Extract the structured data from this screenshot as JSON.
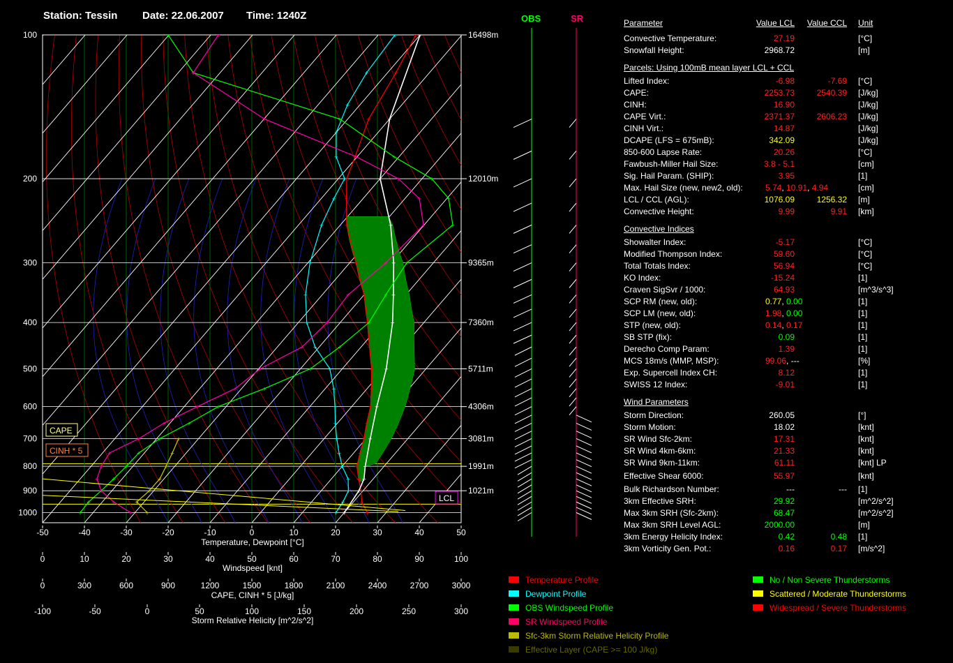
{
  "header": {
    "station": "Station: Tessin",
    "date": "Date: 22.06.2007",
    "time": "Time: 1240Z"
  },
  "chart_data": {
    "type": "line",
    "title": "",
    "xlabel": "Temperature, Dewpoint [°C]",
    "x_ticks": [
      "-50",
      "-40",
      "-30",
      "-20",
      "-10",
      "0",
      "10",
      "20",
      "30",
      "40",
      "50"
    ],
    "y_ticks": [
      "100",
      "200",
      "300",
      "400",
      "500",
      "600",
      "700",
      "800",
      "900",
      "1000"
    ],
    "xlim": [
      -50,
      50
    ],
    "ylim": [
      1000,
      100
    ],
    "y_scale": "log",
    "height_labels": [
      "16498m",
      "12010m",
      "9365m",
      "7360m",
      "5711m",
      "4306m",
      "3081m",
      "1991m",
      "1021m"
    ],
    "height_pressures": [
      100,
      200,
      300,
      400,
      500,
      600,
      700,
      800,
      900
    ],
    "axis2": {
      "label": "Windspeed [knt]",
      "ticks": [
        "0",
        "10",
        "20",
        "30",
        "40",
        "50",
        "60",
        "70",
        "80",
        "90",
        "100"
      ]
    },
    "axis3": {
      "label": "CAPE, CINH * 5 [J/kg]",
      "ticks": [
        "0",
        "300",
        "600",
        "900",
        "1200",
        "1500",
        "1800",
        "2100",
        "2400",
        "2700",
        "3000"
      ]
    },
    "axis4": {
      "label": "Storm Relative Helicity [m^2/s^2]",
      "ticks": [
        "-100",
        "-50",
        "0",
        "50",
        "100",
        "150",
        "200",
        "250",
        "300"
      ]
    },
    "series": [
      {
        "name": "Temperature Profile",
        "color": "#ff0000",
        "points": [
          [
            1000,
            25.5
          ],
          [
            950,
            22.0
          ],
          [
            900,
            19.5
          ],
          [
            850,
            16.5
          ],
          [
            800,
            13.5
          ],
          [
            750,
            11.5
          ],
          [
            700,
            9.5
          ],
          [
            650,
            7.0
          ],
          [
            600,
            4.5
          ],
          [
            550,
            1.0
          ],
          [
            500,
            -3.0
          ],
          [
            450,
            -8.0
          ],
          [
            400,
            -13.5
          ],
          [
            350,
            -20.0
          ],
          [
            300,
            -28.5
          ],
          [
            250,
            -38.5
          ],
          [
            220,
            -44.0
          ],
          [
            200,
            -48.0
          ],
          [
            180,
            -50.5
          ],
          [
            150,
            -55.0
          ],
          [
            120,
            -58.0
          ],
          [
            100,
            -61.0
          ]
        ]
      },
      {
        "name": "Dewpoint Profile",
        "color": "#00ffff",
        "points": [
          [
            1000,
            18.0
          ],
          [
            950,
            17.5
          ],
          [
            900,
            16.5
          ],
          [
            850,
            14.0
          ],
          [
            800,
            10.0
          ],
          [
            750,
            6.5
          ],
          [
            700,
            3.0
          ],
          [
            650,
            -0.5
          ],
          [
            600,
            -4.0
          ],
          [
            550,
            -8.0
          ],
          [
            500,
            -13.0
          ],
          [
            450,
            -21.0
          ],
          [
            400,
            -28.0
          ],
          [
            350,
            -34.0
          ],
          [
            300,
            -39.5
          ],
          [
            250,
            -44.5
          ],
          [
            220,
            -47.0
          ],
          [
            200,
            -48.5
          ],
          [
            180,
            -55.0
          ],
          [
            160,
            -60.0
          ],
          [
            140,
            -63.0
          ],
          [
            120,
            -65.0
          ],
          [
            100,
            -66.0
          ]
        ]
      },
      {
        "name": "Parcel",
        "color": "#ffffff",
        "points": [
          [
            1000,
            20.0
          ],
          [
            900,
            19.0
          ],
          [
            850,
            17.8
          ],
          [
            800,
            15.5
          ],
          [
            700,
            11.0
          ],
          [
            600,
            6.0
          ],
          [
            500,
            0.5
          ],
          [
            400,
            -7.5
          ],
          [
            350,
            -13.0
          ],
          [
            300,
            -19.5
          ],
          [
            250,
            -28.0
          ],
          [
            200,
            -40.0
          ],
          [
            150,
            -50.0
          ],
          [
            100,
            -60.0
          ]
        ]
      },
      {
        "name": "OBS Windspeed Profile",
        "color": "#00ff00",
        "points": [
          [
            1000,
            9
          ],
          [
            950,
            11
          ],
          [
            900,
            14
          ],
          [
            850,
            17
          ],
          [
            800,
            20
          ],
          [
            750,
            23
          ],
          [
            700,
            28
          ],
          [
            650,
            35
          ],
          [
            600,
            42
          ],
          [
            550,
            53
          ],
          [
            500,
            64
          ],
          [
            450,
            71
          ],
          [
            400,
            78
          ],
          [
            350,
            82
          ],
          [
            300,
            87
          ],
          [
            250,
            98
          ],
          [
            220,
            97
          ],
          [
            200,
            93
          ],
          [
            180,
            84
          ],
          [
            150,
            71
          ],
          [
            120,
            36
          ],
          [
            100,
            30
          ]
        ]
      },
      {
        "name": "SR Windspeed Profile",
        "color": "#ff00aa",
        "points": [
          [
            1000,
            21
          ],
          [
            950,
            17
          ],
          [
            900,
            14
          ],
          [
            850,
            13
          ],
          [
            800,
            14
          ],
          [
            750,
            16
          ],
          [
            700,
            23
          ],
          [
            650,
            29
          ],
          [
            600,
            37
          ],
          [
            550,
            46
          ],
          [
            500,
            52
          ],
          [
            450,
            62
          ],
          [
            400,
            68
          ],
          [
            350,
            73
          ],
          [
            300,
            82
          ],
          [
            250,
            91
          ],
          [
            220,
            90
          ],
          [
            200,
            85
          ],
          [
            180,
            75
          ],
          [
            150,
            53
          ],
          [
            120,
            36
          ],
          [
            100,
            42
          ]
        ]
      },
      {
        "name": "Sfc-3km Storm Relative Helicity Profile",
        "color": "#cccc00",
        "points": [
          [
            1000,
            0
          ],
          [
            950,
            -10
          ],
          [
            900,
            2
          ],
          [
            850,
            12
          ],
          [
            800,
            18
          ],
          [
            750,
            24
          ],
          [
            700,
            30
          ]
        ]
      }
    ],
    "cape_label": "CAPE",
    "cinh_label": "CINH * 5",
    "lcl_label": "LCL",
    "legend_placement": "bottom"
  },
  "wind": {
    "obs_label": "OBS",
    "sr_label": "SR",
    "obs_color": "#00ff00",
    "sr_color": "#ff0066"
  },
  "params": {
    "hdr": {
      "name": "Parameter",
      "v1": "Value LCL",
      "v2": "Value CCL",
      "unit": "Unit"
    },
    "rows": [
      {
        "name": "Convective Temperature:",
        "v1": "27.19",
        "c1": "#ff2020",
        "v2": "",
        "unit": "[°C]"
      },
      {
        "name": "Snowfall Height:",
        "v1": "2968.72",
        "c1": "#ffffff",
        "v2": "",
        "unit": "[m]"
      },
      {
        "section": "Parcels: Using 100mB mean layer LCL + CCL"
      },
      {
        "name": "Lifted Index:",
        "v1": "-6.98",
        "c1": "#ff2020",
        "v2": "-7.69",
        "c2": "#ff2020",
        "unit": "[°C]"
      },
      {
        "name": "CAPE:",
        "v1": "2253.73",
        "c1": "#ff2020",
        "v2": "2540.39",
        "c2": "#ff2020",
        "unit": "[J/kg]"
      },
      {
        "name": "CINH:",
        "v1": "16.90",
        "c1": "#ff2020",
        "v2": "",
        "unit": "[J/kg]"
      },
      {
        "name": "CAPE Virt.:",
        "v1": "2371.37",
        "c1": "#ff2020",
        "v2": "2606.23",
        "c2": "#ff2020",
        "unit": "[J/kg]"
      },
      {
        "name": "CINH Virt.:",
        "v1": "14.87",
        "c1": "#ff2020",
        "v2": "",
        "unit": "[J/kg]"
      },
      {
        "name": "DCAPE (LFS = 675mB):",
        "v1": "342.09",
        "c1": "#ffff00",
        "v2": "",
        "unit": "[J/kg]"
      },
      {
        "name": "850-600 Lapse Rate:",
        "v1": "20.26",
        "c1": "#ff2020",
        "v2": "",
        "unit": "[°C]"
      },
      {
        "name": "Fawbush-Miller Hail Size:",
        "v1": "3.8 - 5.1",
        "c1": "#ff2020",
        "v2": "",
        "unit": "[cm]"
      },
      {
        "name": "Sig. Hail Param. (SHIP):",
        "v1": "3.95",
        "c1": "#ff2020",
        "v2": "",
        "unit": "[1]"
      },
      {
        "name": "Max. Hail Size (new, new2, old):",
        "multi": [
          [
            "5.74",
            "#ff2020"
          ],
          [
            ", ",
            "#ffffff"
          ],
          [
            "10.91",
            "#ff2020"
          ],
          [
            ", ",
            "#ffffff"
          ],
          [
            "4.94",
            "#ff2020"
          ]
        ],
        "unit": "[cm]"
      },
      {
        "name": "LCL / CCL (AGL):",
        "v1": "1076.09",
        "c1": "#ffff00",
        "v2": "1256.32",
        "c2": "#ffff00",
        "unit": "[m]"
      },
      {
        "name": "Convective Height:",
        "v1": "9.99",
        "c1": "#ff2020",
        "v2": "9.91",
        "c2": "#ff2020",
        "unit": "[km]"
      },
      {
        "section": "Convective Indices"
      },
      {
        "name": "Showalter Index:",
        "v1": "-5.17",
        "c1": "#ff2020",
        "v2": "",
        "unit": "[°C]"
      },
      {
        "name": "Modified Thompson Index:",
        "v1": "59.60",
        "c1": "#ff2020",
        "v2": "",
        "unit": "[°C]"
      },
      {
        "name": "Total Totals Index:",
        "v1": "56.94",
        "c1": "#ff2020",
        "v2": "",
        "unit": "[°C]"
      },
      {
        "name": "KO Index:",
        "v1": "-15.24",
        "c1": "#ff2020",
        "v2": "",
        "unit": "[1]"
      },
      {
        "name": "Craven SigSvr / 1000:",
        "v1": "64.93",
        "c1": "#ff2020",
        "v2": "",
        "unit": "[m^3/s^3]"
      },
      {
        "name": "SCP RM (new, old):",
        "multi": [
          [
            "0.77",
            "#ffff00"
          ],
          [
            ", ",
            "#ffffff"
          ],
          [
            "0.00",
            "#00ff00"
          ]
        ],
        "unit": "[1]"
      },
      {
        "name": "SCP LM (new, old):",
        "multi": [
          [
            "1.98",
            "#ff2020"
          ],
          [
            ", ",
            "#ffffff"
          ],
          [
            "0.00",
            "#00ff00"
          ]
        ],
        "unit": "[1]"
      },
      {
        "name": "STP (new, old):",
        "multi": [
          [
            "0.14",
            "#ff2020"
          ],
          [
            ", ",
            "#ffffff"
          ],
          [
            "0.17",
            "#ff2020"
          ]
        ],
        "unit": "[1]"
      },
      {
        "name": "SB STP (fix):",
        "v1": "0.09",
        "c1": "#00ff00",
        "v2": "",
        "unit": "[1]"
      },
      {
        "name": "Derecho Comp Param:",
        "v1": "1.39",
        "c1": "#ff2020",
        "v2": "",
        "unit": "[1]"
      },
      {
        "name": "MCS 18m/s (MMP, MSP):",
        "multi": [
          [
            "99.06",
            "#ff2020"
          ],
          [
            ", ",
            "#ffffff"
          ],
          [
            "---",
            "#ffffff"
          ]
        ],
        "unit": "[%]"
      },
      {
        "name": "Exp. Supercell Index CH:",
        "v1": "8.12",
        "c1": "#ff2020",
        "v2": "",
        "unit": "[1]"
      },
      {
        "name": "SWISS 12 Index:",
        "v1": "-9.01",
        "c1": "#ff2020",
        "v2": "",
        "unit": "[1]"
      },
      {
        "section": "Wind Parameters"
      },
      {
        "name": "Storm Direction:",
        "v1": "260.05",
        "c1": "#ffffff",
        "v2": "",
        "unit": "[°]"
      },
      {
        "name": "Storm Motion:",
        "v1": "18.02",
        "c1": "#ffffff",
        "v2": "",
        "unit": "[knt]"
      },
      {
        "name": "SR Wind Sfc-2km:",
        "v1": "17.31",
        "c1": "#ff2020",
        "v2": "",
        "unit": "[knt]"
      },
      {
        "name": "SR Wind 4km-6km:",
        "v1": "21.33",
        "c1": "#ff2020",
        "v2": "",
        "unit": "[knt]"
      },
      {
        "name": "SR Wind 9km-11km:",
        "v1": "61.11",
        "c1": "#ff2020",
        "v2": "",
        "unit": "[knt] LP"
      },
      {
        "name": "Effective Shear 6000:",
        "v1": "55.97",
        "c1": "#ff2020",
        "v2": "",
        "unit": "[knt]"
      },
      {
        "name": "Bulk Richardson Number:",
        "v1": "---",
        "c1": "#ffffff",
        "v2": "---",
        "c2": "#ffffff",
        "unit": "[1]"
      },
      {
        "name": "3km Effective SRH:",
        "v1": "29.92",
        "c1": "#00ff00",
        "v2": "",
        "unit": "[m^2/s^2]"
      },
      {
        "name": "Max 3km SRH (Sfc-2km):",
        "v1": "68.47",
        "c1": "#00ff00",
        "v2": "",
        "unit": "[m^2/s^2]"
      },
      {
        "name": "Max 3km SRH Level AGL:",
        "v1": "2000.00",
        "c1": "#00ff00",
        "v2": "",
        "unit": "[m]"
      },
      {
        "name": "3km Energy Helicity Index:",
        "v1": "0.42",
        "c1": "#00ff00",
        "v2": "0.48",
        "c2": "#00ff00",
        "unit": "[1]"
      },
      {
        "name": "3km Vorticity Gen. Pot.:",
        "v1": "0.16",
        "c1": "#ff2020",
        "v2": "0.17",
        "c2": "#ff2020",
        "unit": "[m/s^2]"
      }
    ]
  },
  "legend_left": [
    {
      "label": "Temperature Profile",
      "color": "#ff0000"
    },
    {
      "label": "Dewpoint Profile",
      "color": "#00ffff"
    },
    {
      "label": "OBS Windspeed Profile",
      "color": "#00ff00"
    },
    {
      "label": "SR Windspeed Profile",
      "color": "#ff0066"
    },
    {
      "label": "Sfc-3km Storm Relative Helicity Profile",
      "color": "#bbbb00"
    },
    {
      "label": "Effective Layer (CAPE >= 100 J/kg)",
      "color": "#3a3a00"
    }
  ],
  "legend_right": [
    {
      "label": "No / Non Severe Thunderstorms",
      "color": "#00ff00"
    },
    {
      "label": "Scattered / Moderate Thunderstorms",
      "color": "#ffff00"
    },
    {
      "label": "Widespread / Severe Thunderstorms",
      "color": "#ff0000"
    }
  ]
}
